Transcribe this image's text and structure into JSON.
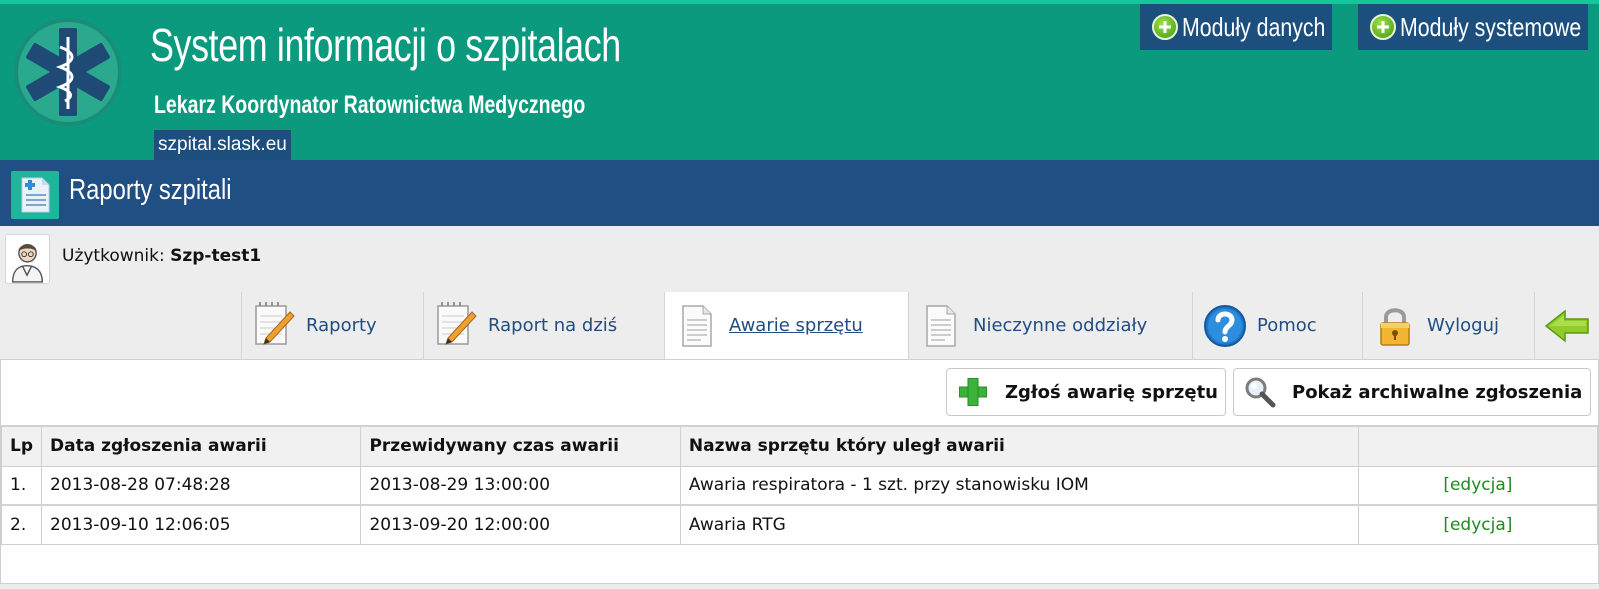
{
  "header": {
    "title": "System informacji o szpitalach",
    "subtitle": "Lekarz Koordynator Ratownictwa Medycznego",
    "url": "szpital.slask.eu",
    "modules": [
      {
        "label": "Moduły danych",
        "icon": "plus-icon"
      },
      {
        "label": "Moduły systemowe",
        "icon": "plus-icon"
      }
    ],
    "logo_icon": "star-of-life-icon"
  },
  "titlebar": {
    "title": "Raporty szpitali",
    "icon": "report-document-icon"
  },
  "user": {
    "label": "Użytkownik:",
    "name": "Szp-test1",
    "icon": "doctor-avatar-icon"
  },
  "tabs": [
    {
      "label": "Raporty",
      "icon": "notepad-pencil-icon",
      "active": false
    },
    {
      "label": "Raport na dziś",
      "icon": "notepad-pencil-icon",
      "active": false
    },
    {
      "label": "Awarie sprzętu",
      "icon": "document-icon",
      "active": true
    },
    {
      "label": "Nieczynne oddziały",
      "icon": "document-icon",
      "active": false
    },
    {
      "label": "Pomoc",
      "icon": "help-icon",
      "active": false
    },
    {
      "label": "Wyloguj",
      "icon": "padlock-icon",
      "active": false
    },
    {
      "label": "",
      "icon": "back-arrow-icon",
      "active": false
    }
  ],
  "actions": {
    "report_failure": "Zgłoś awarię sprzętu",
    "show_archive": "Pokaż archiwalne zgłoszenia"
  },
  "table": {
    "columns": [
      "Lp",
      "Data zgłoszenia awarii",
      "Przewidywany czas awarii",
      "Nazwa sprzętu który uległ awarii",
      ""
    ],
    "rows": [
      {
        "lp": "1.",
        "reported": "2013-08-28 07:48:28",
        "expected": "2013-08-29 13:00:00",
        "name": "Awaria respiratora - 1 szt. przy stanowisku IOM",
        "action": "[edycja]"
      },
      {
        "lp": "2.",
        "reported": "2013-09-10 12:06:05",
        "expected": "2013-09-20 12:00:00",
        "name": "Awaria RTG",
        "action": "[edycja]"
      }
    ]
  },
  "colors": {
    "header_bg": "#0b9a7d",
    "titlebar_bg": "#1f4f83",
    "tab_text": "#214d82",
    "edit_link": "#1d8a1d"
  }
}
